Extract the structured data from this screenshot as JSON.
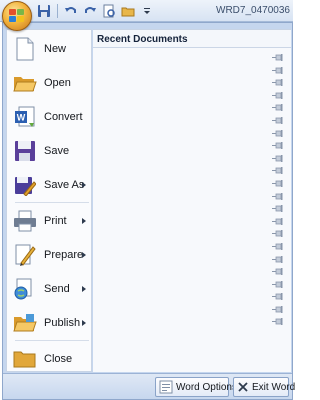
{
  "window": {
    "title": "WRD7_0470036"
  },
  "quick_access": [
    {
      "name": "save-icon"
    },
    {
      "name": "undo-icon"
    },
    {
      "name": "redo-icon"
    },
    {
      "name": "print-preview-icon"
    },
    {
      "name": "open-folder-icon"
    },
    {
      "name": "customize-toolbar-icon"
    }
  ],
  "menu": {
    "commands": [
      {
        "id": "new",
        "label": "New",
        "icon": "new-document-icon",
        "submenu": false
      },
      {
        "id": "open",
        "label": "Open",
        "icon": "open-folder-icon",
        "submenu": false
      },
      {
        "id": "convert",
        "label": "Convert",
        "icon": "convert-icon",
        "submenu": false
      },
      {
        "id": "save",
        "label": "Save",
        "icon": "save-icon",
        "submenu": false
      },
      {
        "id": "save-as",
        "label": "Save As",
        "icon": "save-as-icon",
        "submenu": true
      },
      {
        "id": "print",
        "label": "Print",
        "icon": "printer-icon",
        "submenu": true
      },
      {
        "id": "prepare",
        "label": "Prepare",
        "icon": "prepare-icon",
        "submenu": true
      },
      {
        "id": "send",
        "label": "Send",
        "icon": "send-icon",
        "submenu": true
      },
      {
        "id": "publish",
        "label": "Publish",
        "icon": "publish-icon",
        "submenu": true
      },
      {
        "id": "close",
        "label": "Close",
        "icon": "close-folder-icon",
        "submenu": false
      }
    ],
    "recent": {
      "header": "Recent Documents",
      "item_count": 22
    }
  },
  "footer": {
    "word_options": "Word Options",
    "exit_word": "Exit Word"
  },
  "colors": {
    "menu_bg": "#c5d6ee",
    "accent_orange": "#f3b53e",
    "title_text": "#3b4e6b"
  }
}
